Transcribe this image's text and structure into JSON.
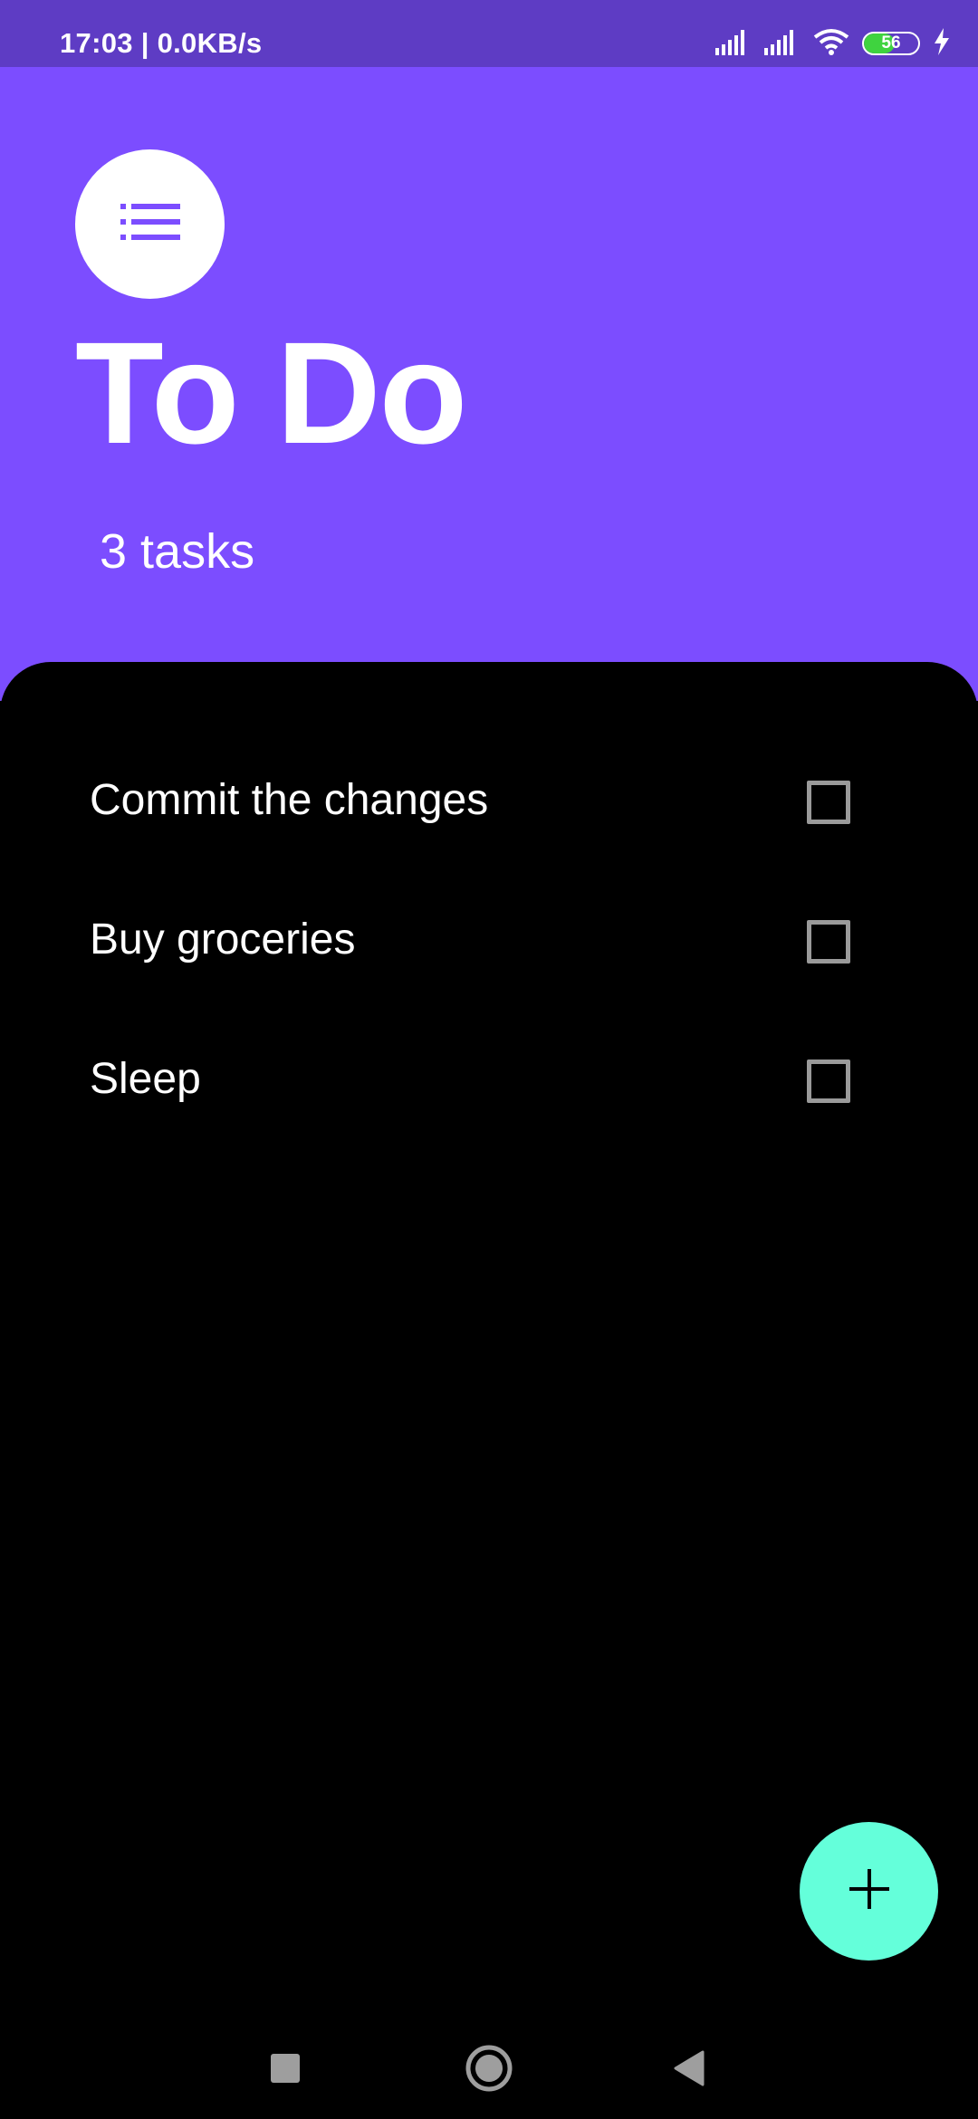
{
  "status_bar": {
    "time_speed": "17:03 | 0.0KB/s",
    "battery_level": "56",
    "battery_fraction": 0.56,
    "icons": [
      "signal-icon",
      "signal-icon",
      "wifi-icon",
      "battery-icon",
      "charging-icon"
    ]
  },
  "header": {
    "title": "To Do",
    "task_count": "3 tasks",
    "icon": "list-icon"
  },
  "tasks": [
    {
      "label": "Commit the changes",
      "checked": false
    },
    {
      "label": "Buy groceries",
      "checked": false
    },
    {
      "label": "Sleep",
      "checked": false
    }
  ],
  "fab": {
    "icon": "plus-icon"
  },
  "colors": {
    "status_bar": "#5e3cc4",
    "header": "#7c4dff",
    "accent": "#64ffda",
    "background": "#000000"
  },
  "nav_bar": {
    "icons": [
      "recent-apps-icon",
      "home-icon",
      "back-icon"
    ]
  }
}
